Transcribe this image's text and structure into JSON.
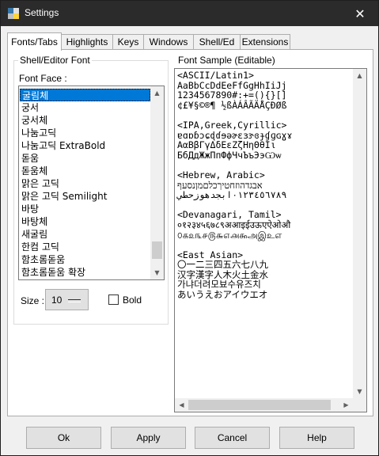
{
  "window": {
    "title": "Settings"
  },
  "tabs": [
    "Fonts/Tabs",
    "Highlights",
    "Keys",
    "Windows",
    "Shell/Ed",
    "Extensions"
  ],
  "group_shell": {
    "label": "Shell/Editor Font"
  },
  "font_face_label": "Font Face :",
  "fonts": [
    "굴림체",
    "궁서",
    "궁서체",
    "나눔고딕",
    "나눔고딕 ExtraBold",
    "돋움",
    "돋움체",
    "맑은 고딕",
    "맑은 고딕 Semilight",
    "바탕",
    "바탕체",
    "새굴림",
    "한컴 고딕",
    "함초롬돋움",
    "함초롬돋움 확장"
  ],
  "selected_font": "굴림체",
  "size": {
    "label": "Size :",
    "value": "10"
  },
  "bold": {
    "label": "Bold",
    "checked": false
  },
  "group_sample": {
    "label": "Font Sample (Editable)"
  },
  "sample_lines": [
    "<ASCII/Latin1>",
    "AaBbCcDdEeFfGgHhIiJj",
    "1234567890#:+=(){}[]",
    "¢£¥§©®¶ ½ßÀÁÂÃÄÅÇÐØß",
    "",
    "<IPA,Greek,Cyrillic>",
    "ɐɑɒɓɔɕɖɗɘəɚɛɜɝɞɟɠɡɢɣɤ",
    "ΑαΒβΓγΔδΕεΖζΗηΘθΙι",
    "БбДдЖжПпФфЧчЪъЭэѠѡ",
    "",
    "<Hebrew, Arabic>",
    "אבגדהוזחטיךכלםמןנסעף",
    "٠١٢٣٤٥٦٧٨٩ابجدهوزحطي",
    "",
    "<Devanagari, Tamil>",
    "०१२३४५६७८९अआइईउऊएऐओऔ",
    "௦௧௨௩௪௫௬௭௮௯அஇஉஎ",
    "",
    "<East Asian>",
    "〇一二三四五六七八九",
    "汉字漢字人木火土金水",
    "가냐더려모뵤수유즈치",
    "あいうえおアイウエオ"
  ],
  "buttons": {
    "ok": "Ok",
    "apply": "Apply",
    "cancel": "Cancel",
    "help": "Help"
  }
}
